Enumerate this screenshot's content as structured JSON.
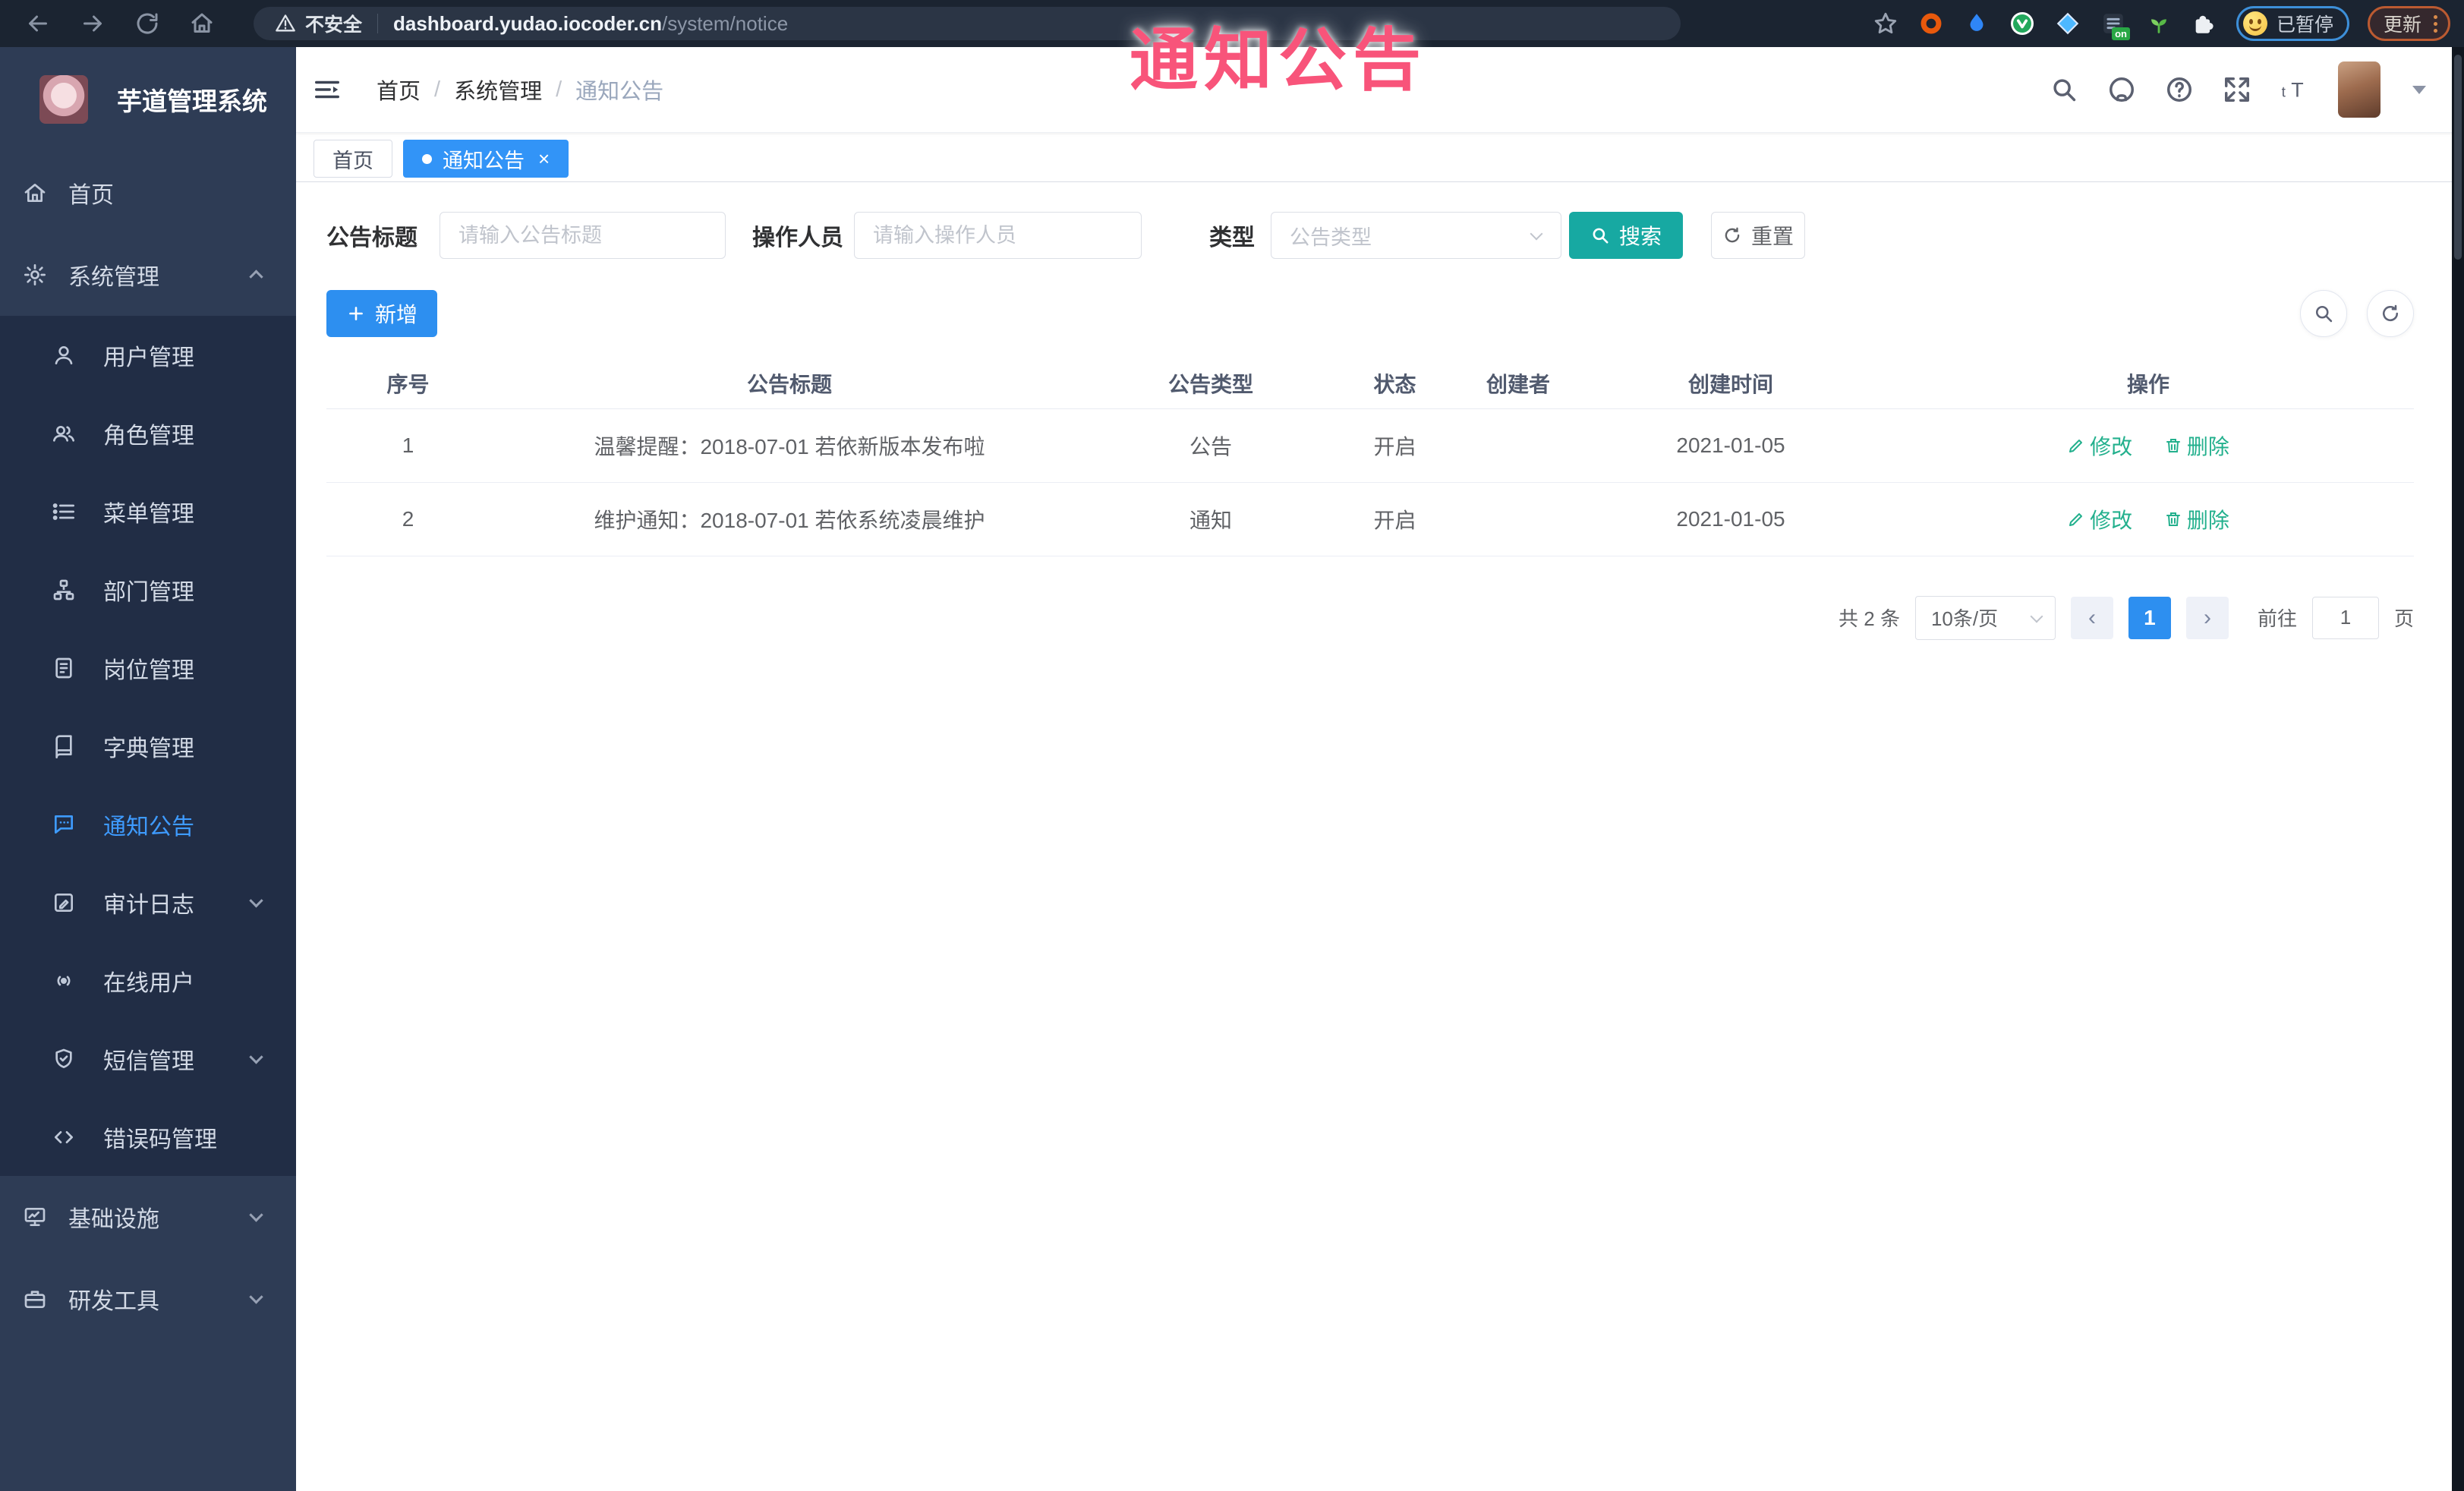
{
  "annotation": {
    "text": "通知公告",
    "color": "#f8547a"
  },
  "chrome": {
    "not_secure_label": "不安全",
    "url_host": "dashboard.yudao.iocoder.cn",
    "url_path": "/system/notice",
    "extension_badge": "on",
    "profile_status_label": "已暂停",
    "update_button_label": "更新"
  },
  "sidebar": {
    "app_title": "芋道管理系统",
    "items": [
      {
        "label": "首页",
        "icon": "home-icon"
      },
      {
        "label": "系统管理",
        "icon": "gear-icon",
        "expanded": true
      },
      {
        "label": "用户管理",
        "icon": "user-icon"
      },
      {
        "label": "角色管理",
        "icon": "roles-icon"
      },
      {
        "label": "菜单管理",
        "icon": "menu-list-icon"
      },
      {
        "label": "部门管理",
        "icon": "org-tree-icon"
      },
      {
        "label": "岗位管理",
        "icon": "post-badge-icon"
      },
      {
        "label": "字典管理",
        "icon": "dictionary-icon"
      },
      {
        "label": "通知公告",
        "icon": "notice-icon",
        "active": true
      },
      {
        "label": "审计日志",
        "icon": "audit-log-icon",
        "collapsed": true
      },
      {
        "label": "在线用户",
        "icon": "online-users-icon"
      },
      {
        "label": "短信管理",
        "icon": "sms-icon",
        "collapsed": true
      },
      {
        "label": "错误码管理",
        "icon": "error-code-icon"
      },
      {
        "label": "基础设施",
        "icon": "infrastructure-icon",
        "collapsed": true
      },
      {
        "label": "研发工具",
        "icon": "dev-tools-icon",
        "collapsed": true
      }
    ]
  },
  "header": {
    "breadcrumb": [
      "首页",
      "系统管理",
      "通知公告"
    ]
  },
  "tabs": [
    {
      "label": "首页",
      "active": false
    },
    {
      "label": "通知公告",
      "active": true
    }
  ],
  "filters": {
    "title_label": "公告标题",
    "title_placeholder": "请输入公告标题",
    "title_value": "",
    "operator_label": "操作人员",
    "operator_placeholder": "请输入操作人员",
    "operator_value": "",
    "type_label": "类型",
    "type_placeholder": "公告类型",
    "search_label": "搜索",
    "reset_label": "重置"
  },
  "toolbar": {
    "add_label": "新增"
  },
  "table": {
    "columns": [
      "序号",
      "公告标题",
      "公告类型",
      "状态",
      "创建者",
      "创建时间",
      "操作"
    ],
    "rows": [
      {
        "index": "1",
        "title": "温馨提醒：2018-07-01 若依新版本发布啦",
        "type": "公告",
        "status": "开启",
        "creator": "",
        "created_at": "2021-01-05"
      },
      {
        "index": "2",
        "title": "维护通知：2018-07-01 若依系统凌晨维护",
        "type": "通知",
        "status": "开启",
        "creator": "",
        "created_at": "2021-01-05"
      }
    ],
    "edit_label": "修改",
    "delete_label": "删除"
  },
  "pagination": {
    "total_text": "共 2 条",
    "page_size_label": "10条/页",
    "current_page": "1",
    "goto_label": "前往",
    "goto_value": "1",
    "page_unit_label": "页"
  },
  "colors": {
    "primary_blue": "#2d8ff0",
    "active_menu_blue": "#3e9bff",
    "search_teal": "#17a9a2",
    "action_link_green": "#23b08d",
    "sidebar_bg": "#2e3c55",
    "submenu_bg": "#212d45",
    "chrome_bg": "#1b2431",
    "annotation_pink": "#f8547a"
  }
}
